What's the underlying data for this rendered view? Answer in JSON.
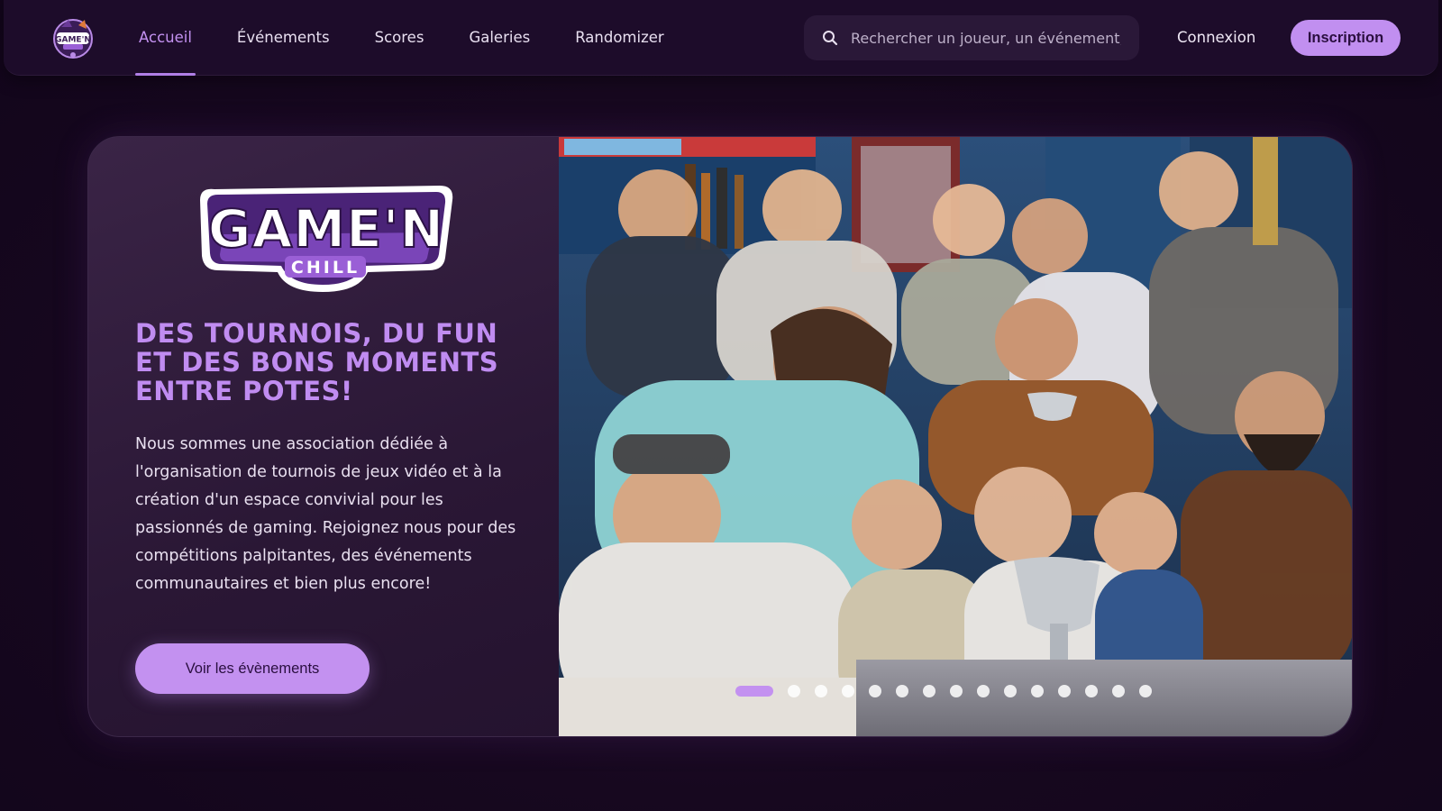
{
  "brand": {
    "name": "GAME'N CHILL",
    "logo_title": "GAME'N",
    "logo_subtitle": "CHILL"
  },
  "nav": {
    "items": [
      {
        "label": "Accueil",
        "active": true
      },
      {
        "label": "Événements",
        "active": false
      },
      {
        "label": "Scores",
        "active": false
      },
      {
        "label": "Galeries",
        "active": false
      },
      {
        "label": "Randomizer",
        "active": false
      }
    ],
    "search_placeholder": "Rechercher un joueur, un événement, ...",
    "login_label": "Connexion",
    "signup_label": "Inscription"
  },
  "hero": {
    "tagline": "DES TOURNOIS, DU FUN ET DES BONS MOMENTS ENTRE POTES!",
    "description": "Nous sommes une association dédiée à l'organisation de tournois de jeux vidéo et à la création d'un espace convivial pour les passionnés de gaming. Rejoignez nous pour des compétitions palpitantes, des événements communautaires et bien plus encore!",
    "cta_label": "Voir les évènements",
    "carousel": {
      "slides": 15,
      "active_index": 0
    }
  },
  "colors": {
    "accent": "#c391f0",
    "accent_text": "#c08cf1",
    "page_bg": "#14061f",
    "nav_bg": "#1d0c2a"
  },
  "icons": {
    "search": "search-icon"
  }
}
